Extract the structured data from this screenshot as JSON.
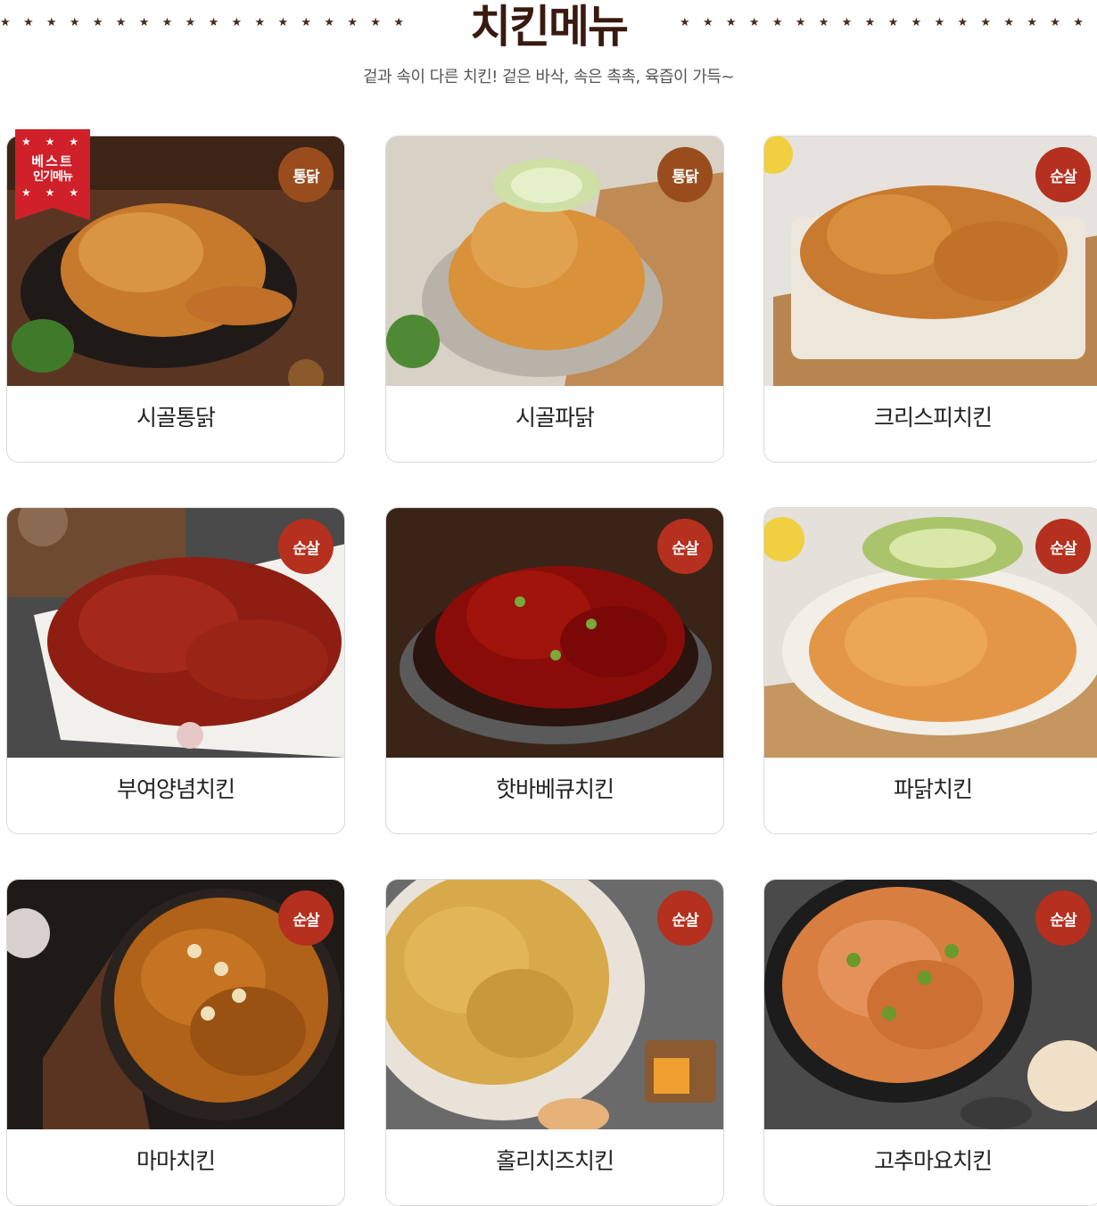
{
  "header": {
    "title": "치킨메뉴",
    "subtitle": "겉과 속이 다른 치킨! 겉은 바삭, 속은 촉촉, 육즙이 가득~",
    "star_row": "★★★★★★★★★★★★★★★★★★"
  },
  "best_ribbon": {
    "line1": "베스트",
    "line2": "인기메뉴",
    "stars_top": "★ ★ ★",
    "stars_bottom": "★ ★ ★"
  },
  "menu": [
    {
      "name": "시골통닭",
      "badge": "통닭"
    },
    {
      "name": "시골파닭",
      "badge": "통닭"
    },
    {
      "name": "크리스피치킨",
      "badge": "순살"
    },
    {
      "name": "부여양념치킨",
      "badge": "순살"
    },
    {
      "name": "핫바베큐치킨",
      "badge": "순살"
    },
    {
      "name": "파닭치킨",
      "badge": "순살"
    },
    {
      "name": "마마치킨",
      "badge": "순살"
    },
    {
      "name": "홀리치즈치킨",
      "badge": "순살"
    },
    {
      "name": "고추마요치킨",
      "badge": "순살"
    }
  ],
  "colors": {
    "title": "#3a1a10",
    "badge_whole": "#9a4d1c",
    "badge_boneless": "#b5301e",
    "best_ribbon": "#d0202a"
  }
}
